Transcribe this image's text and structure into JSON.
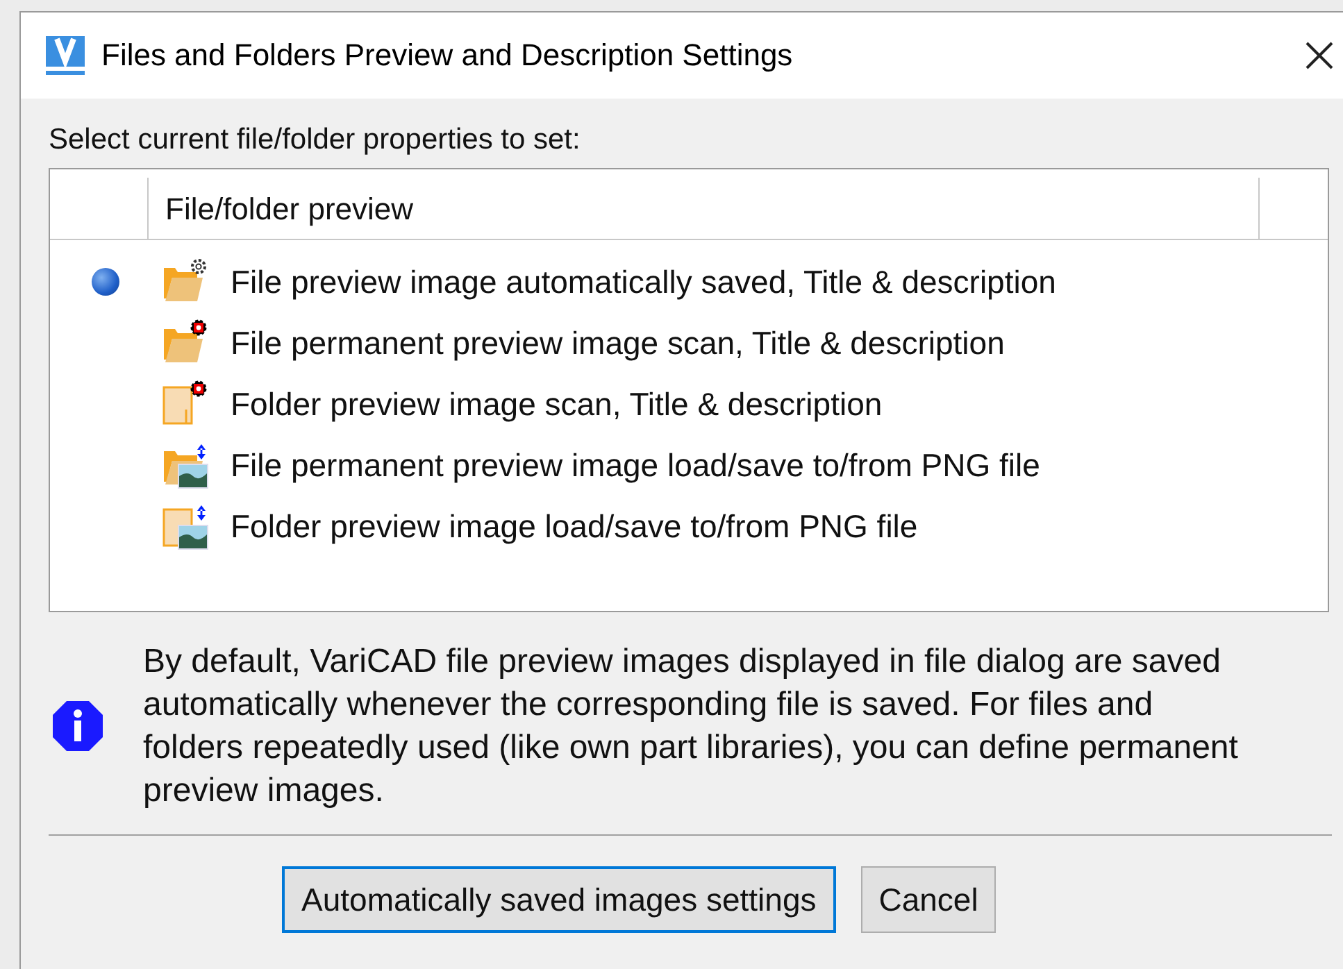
{
  "window": {
    "title": "Files and Folders Preview and Description Settings"
  },
  "prompt": "Select current file/folder properties to set:",
  "table": {
    "columns": [
      "File/folder preview"
    ],
    "rows": [
      {
        "label": "File preview image automatically saved, Title & description",
        "kind": "file-auto",
        "selected": true
      },
      {
        "label": "File permanent preview image scan, Title & description",
        "kind": "file-scan",
        "selected": false
      },
      {
        "label": "Folder preview image scan, Title & description",
        "kind": "folder-scan",
        "selected": false
      },
      {
        "label": "File permanent preview image load/save to/from PNG file",
        "kind": "file-png",
        "selected": false
      },
      {
        "label": "Folder preview image load/save to/from PNG file",
        "kind": "folder-png",
        "selected": false
      }
    ]
  },
  "info": "By default, VariCAD file preview images displayed in file dialog are saved automatically whenever the corresponding file is saved. For files and folders repeatedly used (like own part libraries), you can define permanent preview images.",
  "buttons": [
    {
      "label": "Automatically saved images settings",
      "focused": true
    },
    {
      "label": "Cancel",
      "focused": false
    }
  ]
}
